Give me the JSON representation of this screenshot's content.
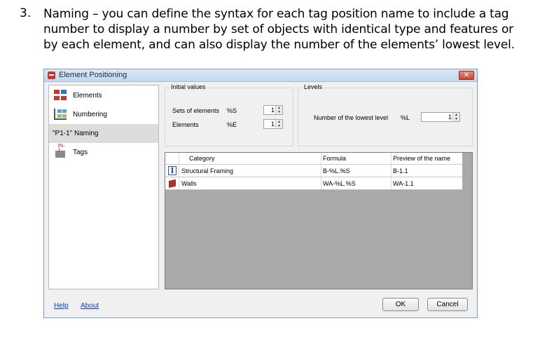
{
  "document": {
    "number": "3.",
    "lines": [
      "Naming – you can define the syntax for each tag position name to include a tag",
      "number to display a number by set of objects with identical type and features or",
      "by each element, and can also display the  number of the elements’ lowest level."
    ]
  },
  "dialog": {
    "title": "Element Positioning",
    "close_label": "✕"
  },
  "sidebar": {
    "items": [
      {
        "label": "Elements",
        "icon": "elements-icon"
      },
      {
        "label": "Numbering",
        "icon": "numbering-icon"
      },
      {
        "label": "\"P1-1\"  Naming",
        "icon": "none"
      },
      {
        "label": "Tags",
        "icon": "tags-icon"
      }
    ],
    "active": "Naming"
  },
  "initial_values": {
    "title": "Initial values",
    "sets_label": "Sets of elements",
    "sets_token": "%S",
    "sets_value": "1",
    "elements_label": "Elements",
    "elements_token": "%E",
    "elements_value": "1"
  },
  "levels": {
    "title": "Levels",
    "lowest_label": "Number of the lowest level",
    "lowest_token": "%L",
    "lowest_value": "1"
  },
  "grid": {
    "headers": {
      "category": "Category",
      "formula": "Formula",
      "preview": "Preview of the name"
    },
    "rows": [
      {
        "icon": "ibeam-icon",
        "category": "Structural Framing",
        "formula": "B-%L.%S",
        "preview": "B-1.1"
      },
      {
        "icon": "wall-icon",
        "category": "Walls",
        "formula": "WA-%L.%S",
        "preview": "WA-1.1"
      }
    ]
  },
  "footer": {
    "help": "Help",
    "about": "About",
    "ok": "OK",
    "cancel": "Cancel"
  },
  "colors": {
    "accent_red": "#c9362a",
    "link_blue": "#0b3fb8"
  }
}
